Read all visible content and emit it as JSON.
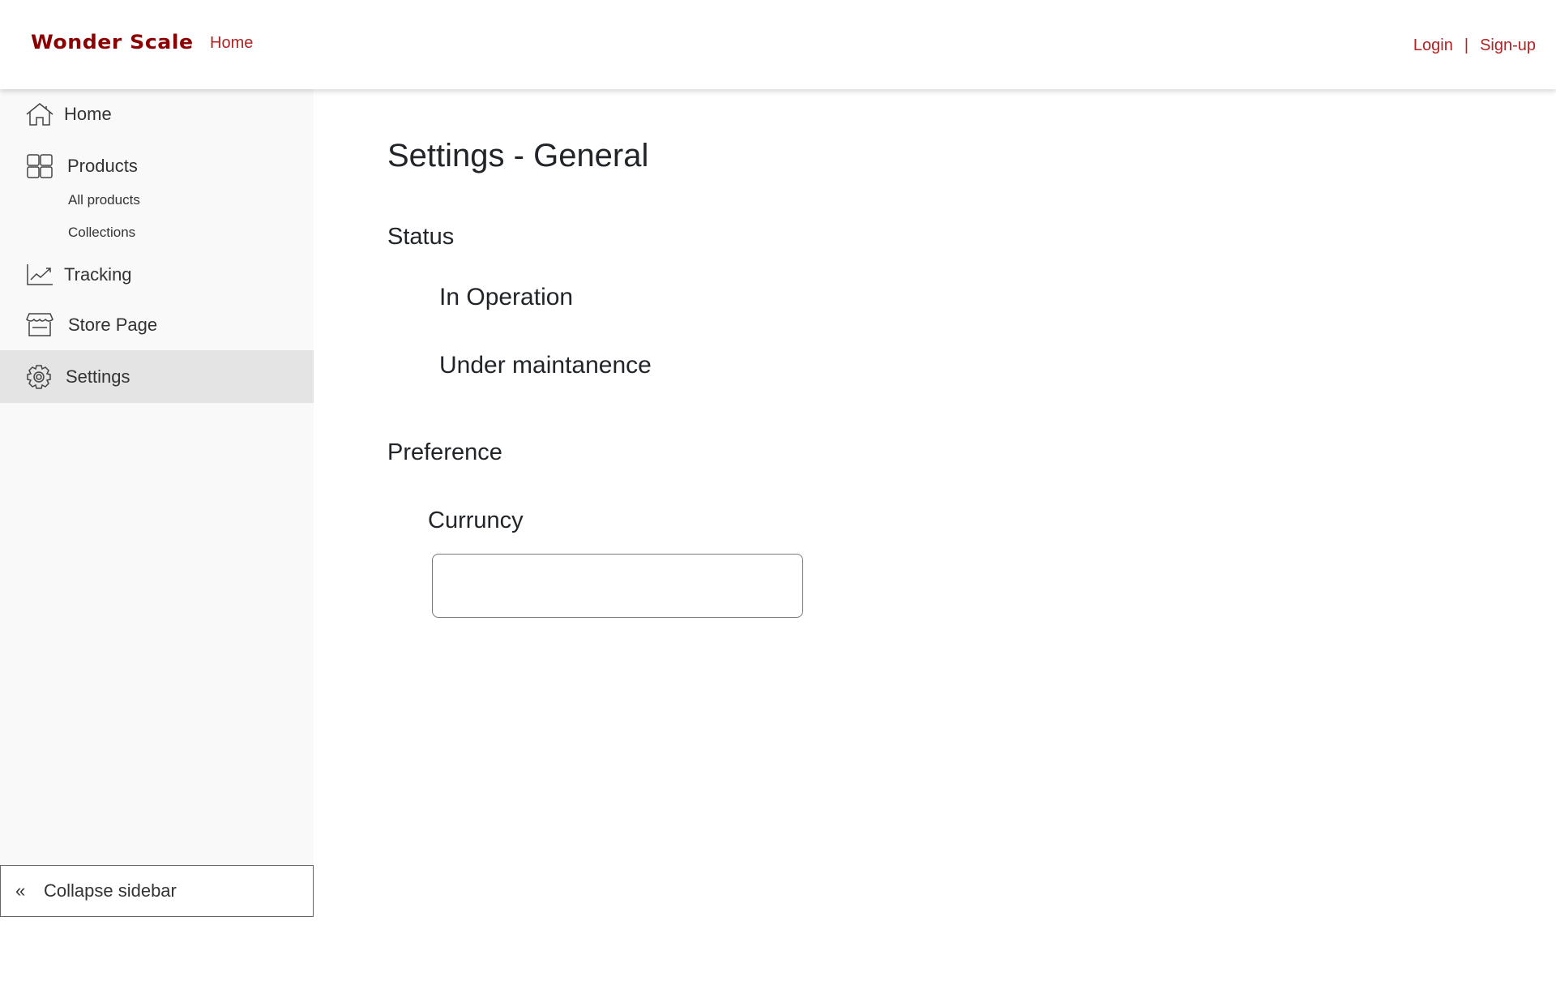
{
  "header": {
    "logo": "Wonder Scale",
    "nav_home": "Home",
    "login": "Login",
    "separator": "|",
    "signup": "Sign-up"
  },
  "sidebar": {
    "items": [
      {
        "label": "Home",
        "icon": "home-icon"
      },
      {
        "label": "Products",
        "icon": "grid-icon",
        "children": [
          {
            "label": "All products"
          },
          {
            "label": "Collections"
          }
        ]
      },
      {
        "label": "Tracking",
        "icon": "chart-icon"
      },
      {
        "label": "Store Page",
        "icon": "store-icon"
      },
      {
        "label": "Settings",
        "icon": "gear-icon",
        "active": true
      }
    ],
    "collapse_label": "Collapse sidebar",
    "collapse_icon": "«"
  },
  "main": {
    "title": "Settings - General",
    "status_heading": "Status",
    "status_options": [
      "In Operation",
      "Under maintanence"
    ],
    "preference_heading": "Preference",
    "currency_label": "Curruncy",
    "currency_value": ""
  },
  "colors": {
    "brand": "#8b0000",
    "link": "#b22222",
    "sidebar_bg": "#f9f9f9",
    "active_bg": "#e4e4e4"
  }
}
